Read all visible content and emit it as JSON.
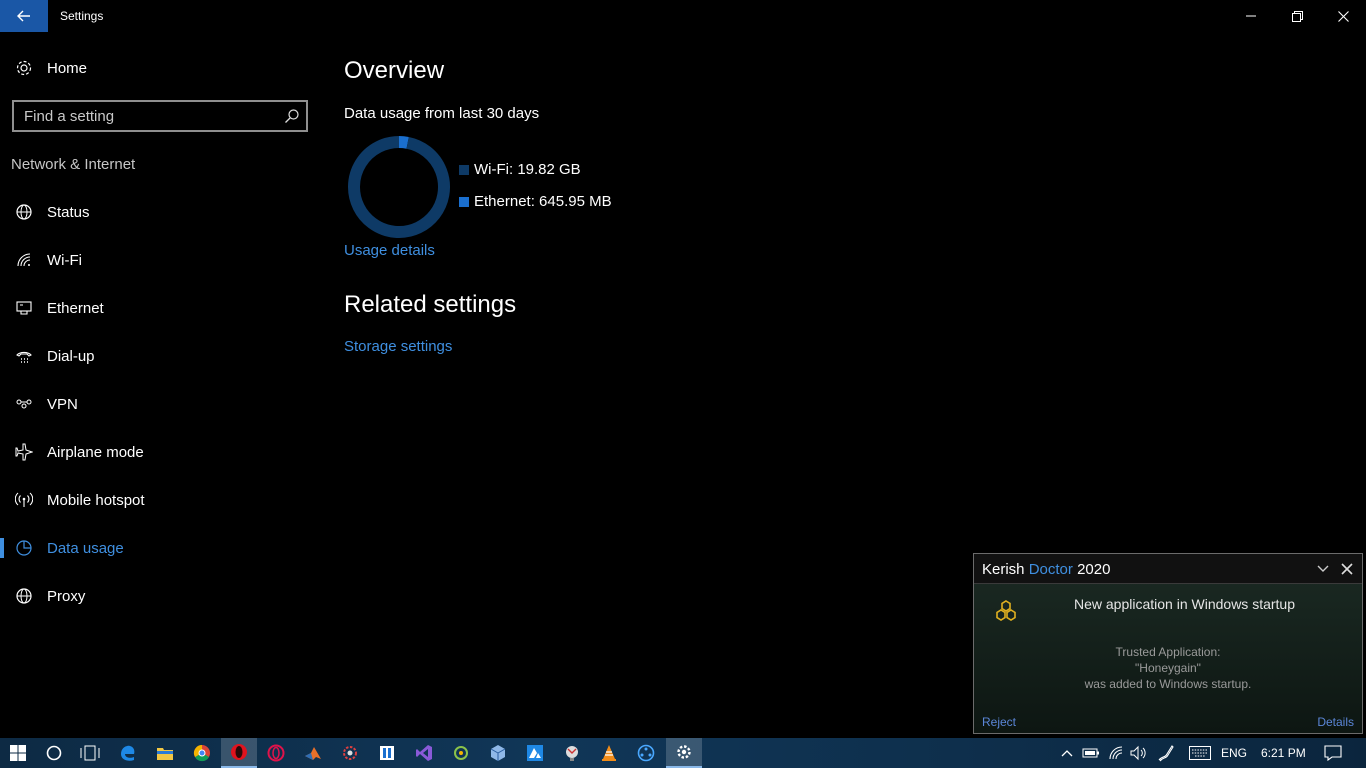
{
  "window": {
    "title": "Settings"
  },
  "sidebar": {
    "home_label": "Home",
    "search_placeholder": "Find a setting",
    "section_label": "Network & Internet",
    "items": [
      {
        "label": "Status",
        "icon": "globe-icon"
      },
      {
        "label": "Wi-Fi",
        "icon": "wifi-icon"
      },
      {
        "label": "Ethernet",
        "icon": "ethernet-icon"
      },
      {
        "label": "Dial-up",
        "icon": "dialup-icon"
      },
      {
        "label": "VPN",
        "icon": "vpn-icon"
      },
      {
        "label": "Airplane mode",
        "icon": "airplane-icon"
      },
      {
        "label": "Mobile hotspot",
        "icon": "hotspot-icon"
      },
      {
        "label": "Data usage",
        "icon": "data-usage-icon",
        "active": true
      },
      {
        "label": "Proxy",
        "icon": "globe-icon"
      }
    ]
  },
  "main": {
    "title": "Overview",
    "subtitle": "Data usage from last 30 days",
    "legend": [
      {
        "label": "Wi-Fi: 19.82 GB",
        "color": "#0e3a66"
      },
      {
        "label": "Ethernet: 645.95 MB",
        "color": "#1a6fcf"
      }
    ],
    "usage_link": "Usage details",
    "related_title": "Related settings",
    "storage_link": "Storage settings"
  },
  "chart_data": {
    "type": "pie",
    "categories": [
      "Wi-Fi",
      "Ethernet"
    ],
    "values": [
      19.82,
      0.63
    ],
    "colors": [
      "#0e3a66",
      "#1a6fcf"
    ]
  },
  "notification": {
    "app_name_1": "Kerish",
    "app_name_2": "Doctor",
    "app_name_3": "2020",
    "heading": "New application in Windows startup",
    "line1": "Trusted Application:",
    "line2": "\"Honeygain\"",
    "line3": "was added to Windows startup.",
    "reject": "Reject",
    "details": "Details"
  },
  "taskbar": {
    "language": "ENG",
    "time": "6:21 PM",
    "apps": [
      "start-icon",
      "cortana-icon",
      "task-view-icon",
      "edge-icon",
      "file-explorer-icon",
      "chrome-icon",
      "opera-icon",
      "opera-gx-icon",
      "matlab-icon",
      "app-gear-icon",
      "app-box-icon",
      "visual-studio-icon",
      "app-green-icon",
      "virtualbox-icon",
      "azure-icon",
      "app-ball-icon",
      "vlc-icon",
      "app-wheel-icon",
      "settings-icon"
    ]
  },
  "colors": {
    "accent": "#3f8fe0",
    "back_button": "#1a57a6"
  }
}
